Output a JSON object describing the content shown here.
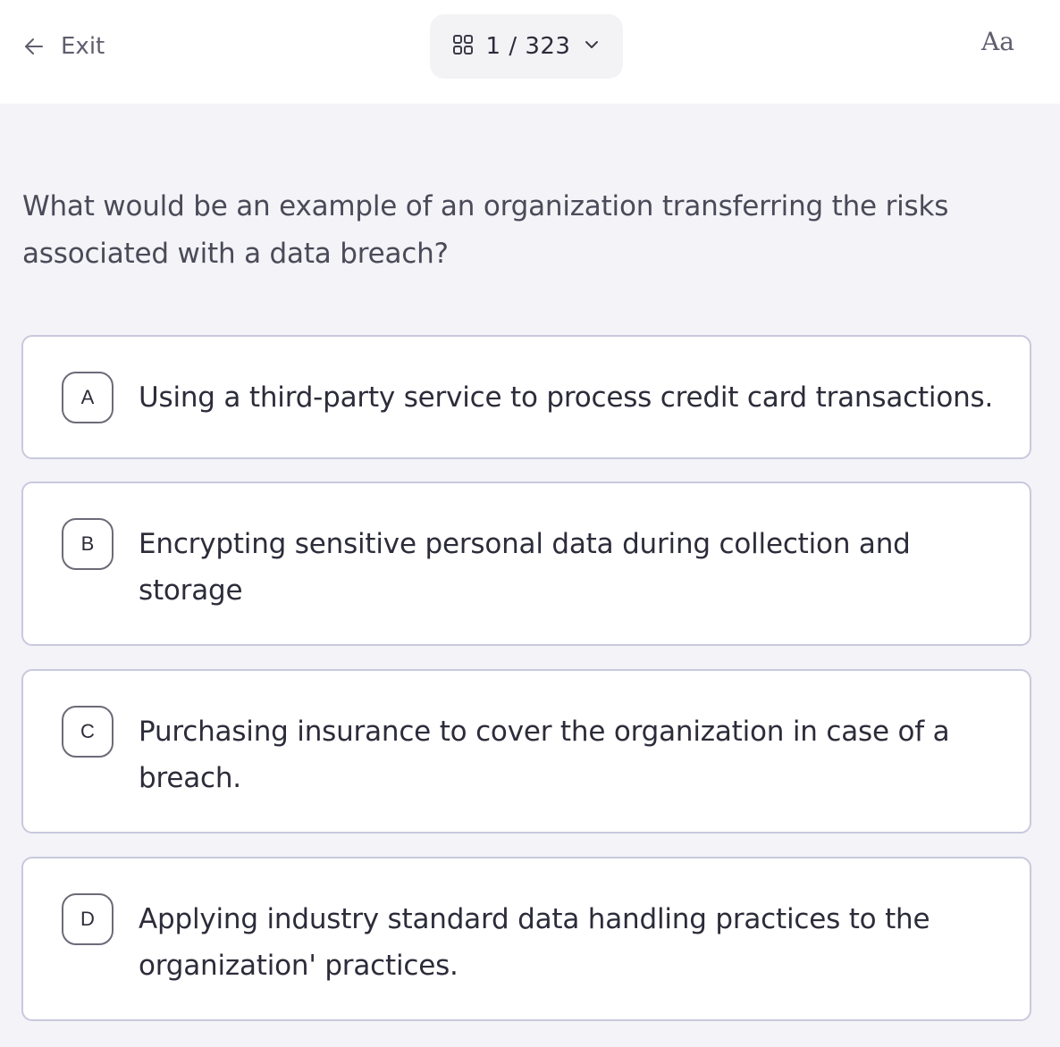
{
  "header": {
    "exit_label": "Exit",
    "counter": "1 / 323",
    "font_toggle": "Aa"
  },
  "question": {
    "text": "What would be an example of an organization transferring the risks associated with a data breach?"
  },
  "options": [
    {
      "letter": "A",
      "text": "Using a third-party service to process credit card transactions."
    },
    {
      "letter": "B",
      "text": "Encrypting sensitive personal data during collection and storage"
    },
    {
      "letter": "C",
      "text": "Purchasing insurance to cover the organization in case of a breach."
    },
    {
      "letter": "D",
      "text": "Applying industry standard data handling practices to the organization' practices."
    }
  ]
}
